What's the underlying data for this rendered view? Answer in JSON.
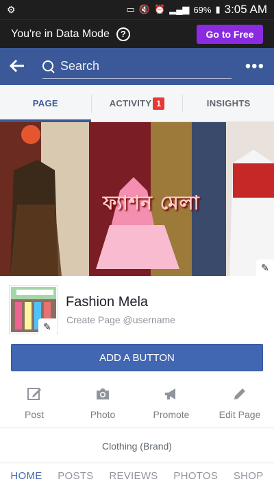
{
  "status_bar": {
    "battery": "69%",
    "time": "3:05 AM"
  },
  "data_bar": {
    "message": "You're in Data Mode",
    "cta": "Go to Free"
  },
  "search": {
    "placeholder": "Search"
  },
  "tabs": [
    {
      "label": "PAGE"
    },
    {
      "label": "ACTIVITY",
      "badge": "1"
    },
    {
      "label": "INSIGHTS"
    }
  ],
  "cover": {
    "title": "ফ্যাশন মেলা"
  },
  "profile": {
    "name": "Fashion Mela",
    "username_prompt": "Create Page @username"
  },
  "add_button": {
    "label": "ADD A BUTTON"
  },
  "actions": [
    {
      "label": "Post",
      "icon": "edit-square-icon"
    },
    {
      "label": "Photo",
      "icon": "camera-icon"
    },
    {
      "label": "Promote",
      "icon": "megaphone-icon"
    },
    {
      "label": "Edit Page",
      "icon": "pencil-icon"
    }
  ],
  "category": "Clothing (Brand)",
  "bottom_nav": [
    {
      "label": "HOME"
    },
    {
      "label": "POSTS"
    },
    {
      "label": "REVIEWS"
    },
    {
      "label": "PHOTOS"
    },
    {
      "label": "SHOP"
    }
  ],
  "colors": {
    "facebook_blue": "#3b5998",
    "button_blue": "#4267b2",
    "free_purple": "#8a2be2",
    "badge_red": "#e53935"
  }
}
